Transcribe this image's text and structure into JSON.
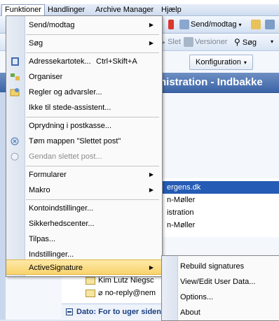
{
  "menubar": {
    "items": [
      "Funktioner",
      "Handlinger",
      "Archive Manager",
      "Hjælp"
    ],
    "active": "Funktioner"
  },
  "toolbar": {
    "send_receive": "Send/modtag",
    "slet": "Slet",
    "versioner": "Versioner",
    "sog": "Søg"
  },
  "configuration_button": "Konfiguration",
  "folder_title": "nistration - Indbakke",
  "list_rows": [
    "ergens.dk",
    "n-Møller",
    "istration",
    "n-Møller"
  ],
  "bottom_list": {
    "sender1": "Kim Lutz Niegsc",
    "sender2": "no-reply@nem",
    "group_label": "Dato: For to uger siden"
  },
  "menu": {
    "items": [
      {
        "label": "Send/modtag",
        "submenu": true
      },
      {
        "label": "Søg",
        "submenu": true
      },
      {
        "label": "Adressekartotek...",
        "shortcut": "Ctrl+Skift+A",
        "icon": "address-book-icon"
      },
      {
        "label": "Organiser",
        "icon": "organize-icon"
      },
      {
        "label": "Regler og advarsler...",
        "icon": "rules-icon"
      },
      {
        "label": "Ikke til stede-assistent..."
      },
      {
        "label": "Oprydning i postkasse..."
      },
      {
        "label": "Tøm mappen \"Slettet post\"",
        "icon": "empty-trash-icon"
      },
      {
        "label": "Gendan slettet post...",
        "disabled": true,
        "icon": "recover-icon"
      },
      {
        "label": "Formularer",
        "submenu": true
      },
      {
        "label": "Makro",
        "submenu": true
      },
      {
        "label": "Kontoindstillinger..."
      },
      {
        "label": "Sikkerhedscenter..."
      },
      {
        "label": "Tilpas..."
      },
      {
        "label": "Indstillinger..."
      },
      {
        "label": "ActiveSignature",
        "submenu": true,
        "highlighted": true
      }
    ]
  },
  "submenu": {
    "items": [
      "Rebuild signatures",
      "View/Edit User Data...",
      "Options...",
      "About"
    ]
  },
  "colors": {
    "highlight": "#f9d36c",
    "folder_header": "#3b64a6",
    "selection": "#245bb4"
  }
}
